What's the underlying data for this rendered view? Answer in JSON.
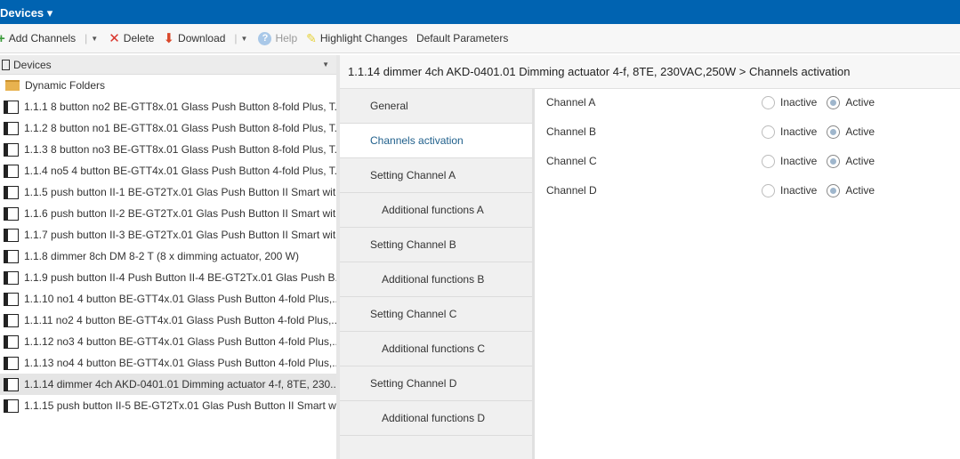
{
  "topbar": {
    "title": "Devices ▾"
  },
  "toolbar": {
    "add_channels": "Add Channels",
    "delete": "Delete",
    "download": "Download",
    "help": "Help",
    "highlight_changes": "Highlight Changes",
    "default_parameters": "Default Parameters"
  },
  "tree": {
    "header": "Devices",
    "folder": "Dynamic Folders",
    "items": [
      "1.1.1 8 button no2 BE-GTT8x.01 Glass Push Button 8-fold Plus, T...",
      "1.1.2 8 button no1 BE-GTT8x.01 Glass Push Button 8-fold Plus, T...",
      "1.1.3 8 button no3 BE-GTT8x.01 Glass Push Button 8-fold Plus, T...",
      "1.1.4 no5 4 button BE-GTT4x.01 Glass Push Button 4-fold Plus, T...",
      "1.1.5 push button II-1 BE-GT2Tx.01 Glas Push Button II Smart wit...",
      "1.1.6 push button II-2 BE-GT2Tx.01 Glas Push Button II Smart wit...",
      "1.1.7 push button II-3 BE-GT2Tx.01 Glas Push Button II Smart wit...",
      "1.1.8 dimmer 8ch DM 8-2 T (8 x dimming actuator, 200 W)",
      "1.1.9 push button II-4 Push Button II-4 BE-GT2Tx.01 Glas Push B...",
      "1.1.10 no1 4 button BE-GTT4x.01 Glass Push Button 4-fold Plus,...",
      "1.1.11 no2 4 button BE-GTT4x.01 Glass Push Button 4-fold Plus,...",
      "1.1.12 no3 4 button BE-GTT4x.01 Glass Push Button 4-fold Plus,...",
      "1.1.13 no4 4 button BE-GTT4x.01 Glass Push Button 4-fold Plus,...",
      "1.1.14 dimmer 4ch AKD-0401.01 Dimming actuator 4-f, 8TE, 230...",
      "1.1.15 push button II-5 BE-GT2Tx.01 Glas Push Button II Smart w..."
    ]
  },
  "detail": {
    "title": "1.1.14 dimmer 4ch AKD-0401.01 Dimming actuator 4-f, 8TE, 230VAC,250W > Channels activation"
  },
  "nav": [
    "General",
    "Channels activation",
    "Setting Channel A",
    "Additional functions A",
    "Setting Channel B",
    "Additional functions B",
    "Setting Channel C",
    "Additional functions C",
    "Setting Channel D",
    "Additional functions D"
  ],
  "channels": [
    {
      "label": "Channel A",
      "inactive": "Inactive",
      "active": "Active",
      "value": "Active"
    },
    {
      "label": "Channel B",
      "inactive": "Inactive",
      "active": "Active",
      "value": "Active"
    },
    {
      "label": "Channel C",
      "inactive": "Inactive",
      "active": "Active",
      "value": "Active"
    },
    {
      "label": "Channel D",
      "inactive": "Inactive",
      "active": "Active",
      "value": "Active"
    }
  ]
}
